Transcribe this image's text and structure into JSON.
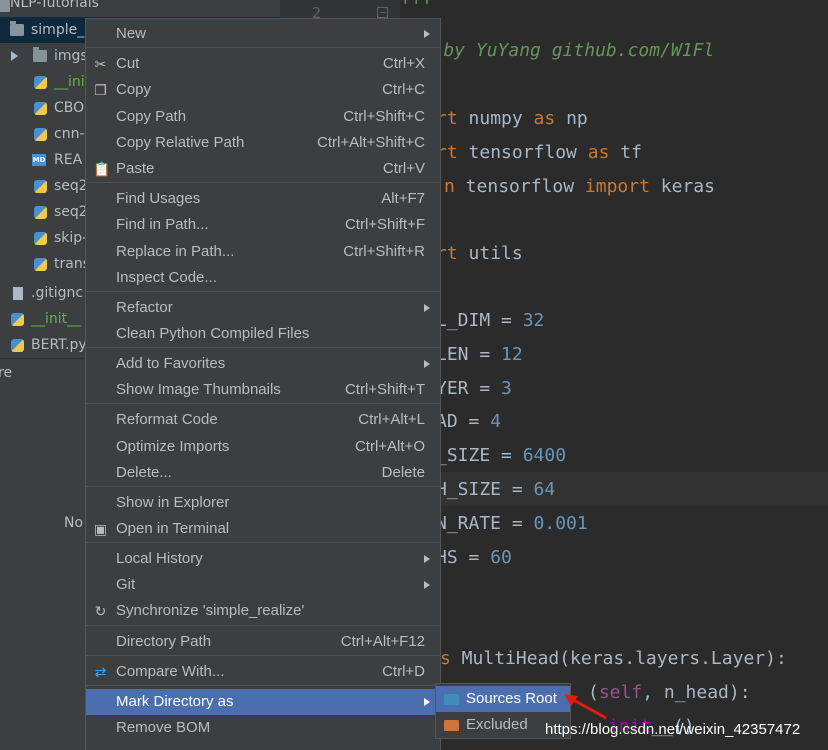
{
  "project_tree": {
    "root": "NLP-Tutorials",
    "items": [
      {
        "label": "simple_",
        "icon": "folder-icon"
      },
      {
        "label": "imgs",
        "icon": "folder-icon"
      },
      {
        "label": "__ini",
        "icon": "python-file-icon"
      },
      {
        "label": "CBO",
        "icon": "python-file-icon"
      },
      {
        "label": "cnn-",
        "icon": "python-file-icon"
      },
      {
        "label": "REA",
        "icon": "markdown-file-icon"
      },
      {
        "label": "seq2",
        "icon": "python-file-icon"
      },
      {
        "label": "seq2",
        "icon": "python-file-icon"
      },
      {
        "label": "skip-",
        "icon": "python-file-icon"
      },
      {
        "label": "trans",
        "icon": "python-file-icon"
      },
      {
        "label": ".gitignc",
        "icon": "file-icon"
      },
      {
        "label": "__init__",
        "icon": "python-file-icon"
      },
      {
        "label": "BERT.py",
        "icon": "python-file-icon"
      }
    ],
    "md_badge": "MD",
    "bottom_panel_title": "re",
    "bottom_panel_text": "No"
  },
  "editor": {
    "line_number": "2",
    "lines": [
      {
        "segments": [
          {
            "t": "'''",
            "c": "cmt"
          }
        ]
      },
      {
        "segments": [
          {
            "t": "ted by YuYang github.com/W1Fl",
            "c": "cmt"
          }
        ]
      },
      {
        "segments": [
          {
            "t": "rt",
            "c": "kw"
          },
          {
            "t": " numpy ",
            "c": ""
          },
          {
            "t": "as",
            "c": "kw"
          },
          {
            "t": " np",
            "c": ""
          }
        ]
      },
      {
        "segments": [
          {
            "t": "rt",
            "c": "kw"
          },
          {
            "t": " tensorflow ",
            "c": ""
          },
          {
            "t": "as",
            "c": "kw"
          },
          {
            "t": " tf",
            "c": ""
          }
        ]
      },
      {
        "segments": [
          {
            "t": "n",
            "c": "kw"
          },
          {
            "t": " tensorflow ",
            "c": ""
          },
          {
            "t": "import",
            "c": "kw"
          },
          {
            "t": " keras",
            "c": ""
          }
        ]
      },
      {
        "segments": [
          {
            "t": "rt",
            "c": "kw"
          },
          {
            "t": " utils",
            "c": ""
          }
        ]
      },
      {
        "segments": [
          {
            "t": "L_DIM = ",
            "c": ""
          },
          {
            "t": "32",
            "c": "num"
          }
        ]
      },
      {
        "segments": [
          {
            "t": "LEN = ",
            "c": ""
          },
          {
            "t": "12",
            "c": "num"
          }
        ]
      },
      {
        "segments": [
          {
            "t": "YER = ",
            "c": ""
          },
          {
            "t": "3",
            "c": "num"
          }
        ]
      },
      {
        "segments": [
          {
            "t": "AD = ",
            "c": ""
          },
          {
            "t": "4",
            "c": "num"
          }
        ]
      },
      {
        "segments": [
          {
            "t": "_SIZE = ",
            "c": ""
          },
          {
            "t": "6400",
            "c": "num"
          }
        ]
      },
      {
        "segments": [
          {
            "t": "H_SIZE = ",
            "c": ""
          },
          {
            "t": "64",
            "c": "num"
          }
        ]
      },
      {
        "segments": [
          {
            "t": "N_RATE = ",
            "c": ""
          },
          {
            "t": "0.001",
            "c": "num"
          }
        ]
      },
      {
        "segments": [
          {
            "t": "HS = ",
            "c": ""
          },
          {
            "t": "60",
            "c": "num"
          }
        ]
      },
      {
        "segments": [
          {
            "t": "s",
            "c": "kw"
          },
          {
            "t": " MultiHead(keras.layers.Layer):",
            "c": ""
          }
        ]
      },
      {
        "segments": [
          {
            "t": "(",
            "c": ""
          },
          {
            "t": "self",
            "c": "self"
          },
          {
            "t": ", n_head):",
            "c": ""
          }
        ]
      },
      {
        "segments": [
          {
            "t": "init",
            "c": "magic"
          },
          {
            "t": "__()",
            "c": ""
          }
        ]
      }
    ]
  },
  "context_menu": {
    "items": [
      {
        "label": "New",
        "submenu": true
      },
      {
        "label": "Cut",
        "shortcut": "Ctrl+X",
        "icon": "scissors-icon"
      },
      {
        "label": "Copy",
        "shortcut": "Ctrl+C",
        "icon": "copy-icon"
      },
      {
        "label": "Copy Path",
        "shortcut": "Ctrl+Shift+C"
      },
      {
        "label": "Copy Relative Path",
        "shortcut": "Ctrl+Alt+Shift+C"
      },
      {
        "label": "Paste",
        "shortcut": "Ctrl+V",
        "icon": "clipboard-icon"
      },
      {
        "label": "Find Usages",
        "shortcut": "Alt+F7"
      },
      {
        "label": "Find in Path...",
        "shortcut": "Ctrl+Shift+F"
      },
      {
        "label": "Replace in Path...",
        "shortcut": "Ctrl+Shift+R"
      },
      {
        "label": "Inspect Code..."
      },
      {
        "label": "Refactor",
        "submenu": true
      },
      {
        "label": "Clean Python Compiled Files"
      },
      {
        "label": "Add to Favorites",
        "submenu": true
      },
      {
        "label": "Show Image Thumbnails",
        "shortcut": "Ctrl+Shift+T"
      },
      {
        "label": "Reformat Code",
        "shortcut": "Ctrl+Alt+L"
      },
      {
        "label": "Optimize Imports",
        "shortcut": "Ctrl+Alt+O"
      },
      {
        "label": "Delete...",
        "shortcut": "Delete"
      },
      {
        "label": "Show in Explorer"
      },
      {
        "label": "Open in Terminal",
        "icon": "terminal-icon"
      },
      {
        "label": "Local History",
        "submenu": true
      },
      {
        "label": "Git",
        "submenu": true
      },
      {
        "label": "Synchronize 'simple_realize'",
        "icon": "sync-icon"
      },
      {
        "label": "Directory Path",
        "shortcut": "Ctrl+Alt+F12"
      },
      {
        "label": "Compare With...",
        "shortcut": "Ctrl+D",
        "icon": "compare-icon"
      },
      {
        "label": "Mark Directory as",
        "submenu": true,
        "active": true
      },
      {
        "label": "Remove BOM"
      }
    ]
  },
  "submenu": {
    "items": [
      {
        "label": "Sources Root",
        "color": "#3d8fb8",
        "active": true
      },
      {
        "label": "Excluded",
        "color": "#d0743d"
      }
    ]
  },
  "watermark": "https://blog.csdn.net/weixin_42357472",
  "colors": {
    "menu_bg": "#3c3f41",
    "selection": "#4b6eaf",
    "editor_bg": "#2b2b2b",
    "arrow": "#e8190d"
  }
}
